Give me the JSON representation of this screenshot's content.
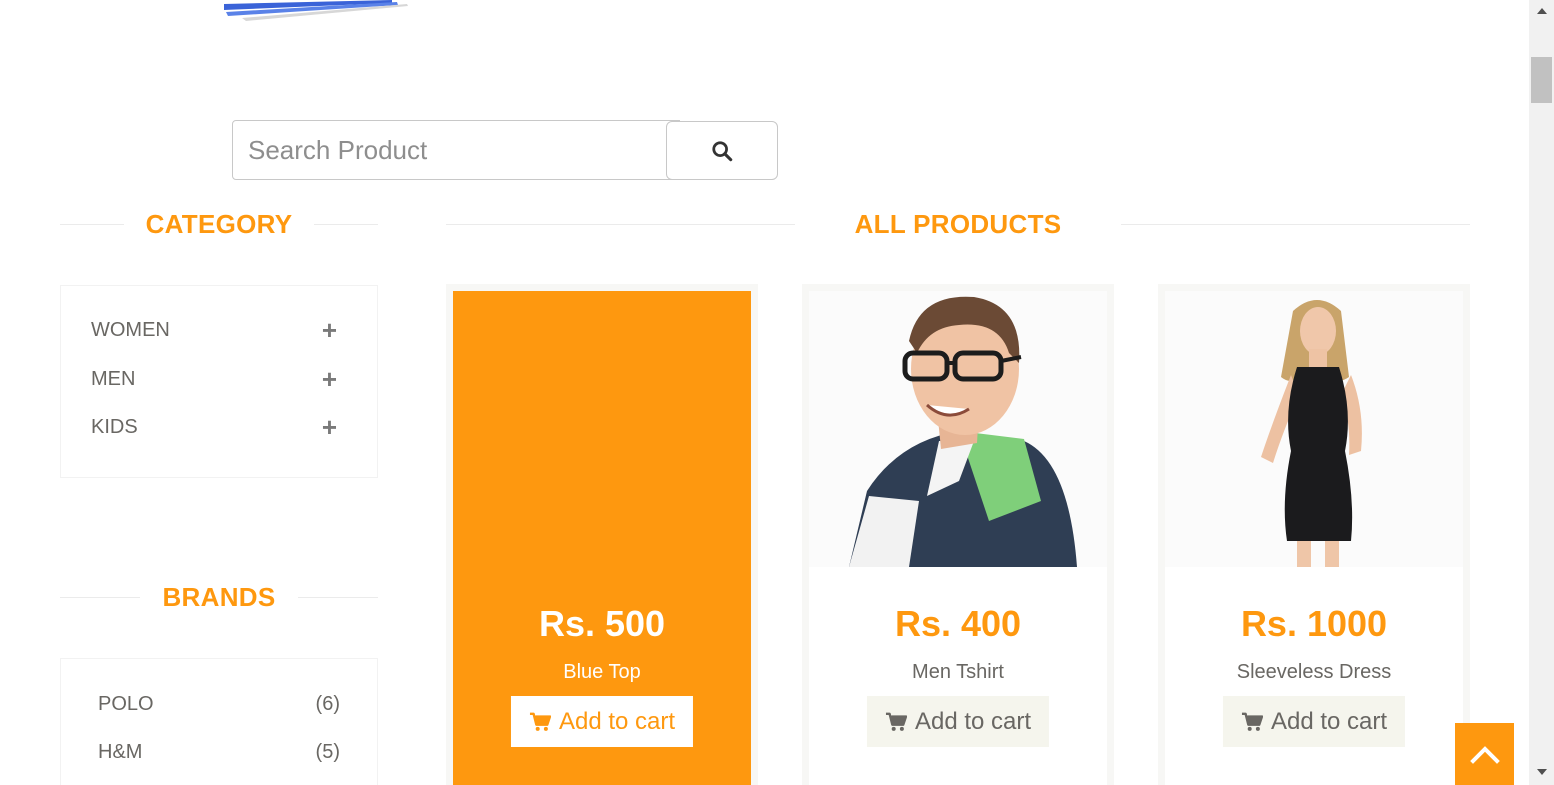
{
  "search": {
    "placeholder": "Search Product",
    "value": ""
  },
  "sidebar": {
    "category_title": "CATEGORY",
    "categories": [
      {
        "label": "WOMEN",
        "expand": "+"
      },
      {
        "label": "MEN",
        "expand": "+"
      },
      {
        "label": "KIDS",
        "expand": "+"
      }
    ],
    "brands_title": "BRANDS",
    "brands": [
      {
        "label": "POLO",
        "count": "(6)"
      },
      {
        "label": "H&M",
        "count": "(5)"
      }
    ]
  },
  "main": {
    "title": "ALL PRODUCTS",
    "products": [
      {
        "price": "Rs. 500",
        "name": "Blue Top",
        "cart_label": "Add to cart",
        "hovered": true
      },
      {
        "price": "Rs. 400",
        "name": "Men Tshirt",
        "cart_label": "Add to cart",
        "hovered": false
      },
      {
        "price": "Rs. 1000",
        "name": "Sleeveless Dress",
        "cart_label": "Add to cart",
        "hovered": false
      }
    ]
  },
  "icons": {
    "search": "search-icon",
    "cart": "shopping-cart-icon",
    "scroll_up": "chevron-up-icon",
    "plus": "plus-icon"
  },
  "colors": {
    "accent": "#fe980f",
    "text": "#696763",
    "button_bg": "#f5f5ed"
  }
}
